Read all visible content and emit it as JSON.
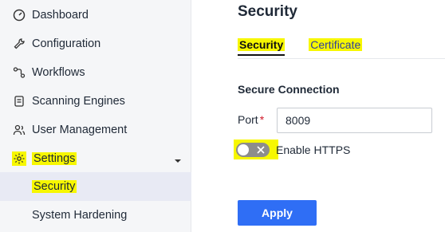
{
  "sidebar": {
    "items": [
      {
        "label": "Dashboard",
        "icon": "dashboard-gauge-icon"
      },
      {
        "label": "Configuration",
        "icon": "wrench-icon"
      },
      {
        "label": "Workflows",
        "icon": "workflow-icon"
      },
      {
        "label": "Scanning Engines",
        "icon": "engine-icon"
      },
      {
        "label": "User Management",
        "icon": "users-icon"
      },
      {
        "label": "Settings",
        "icon": "gear-icon"
      }
    ],
    "settings_children": [
      {
        "label": "Security"
      },
      {
        "label": "System Hardening"
      }
    ]
  },
  "main": {
    "title": "Security",
    "tabs": [
      {
        "label": "Security"
      },
      {
        "label": "Certificate"
      }
    ],
    "section_title": "Secure Connection",
    "port": {
      "label": "Port",
      "required_mark": "*",
      "value": "8009"
    },
    "https_toggle": {
      "label": "Enable HTTPS",
      "enabled": false
    },
    "apply_label": "Apply"
  },
  "colors": {
    "highlight": "#f7f700",
    "accent": "#2f6ef5",
    "tab_link": "#2f3e9e",
    "sidebar_bg": "#f5f6f8",
    "active_bg": "#e8eaf4"
  }
}
